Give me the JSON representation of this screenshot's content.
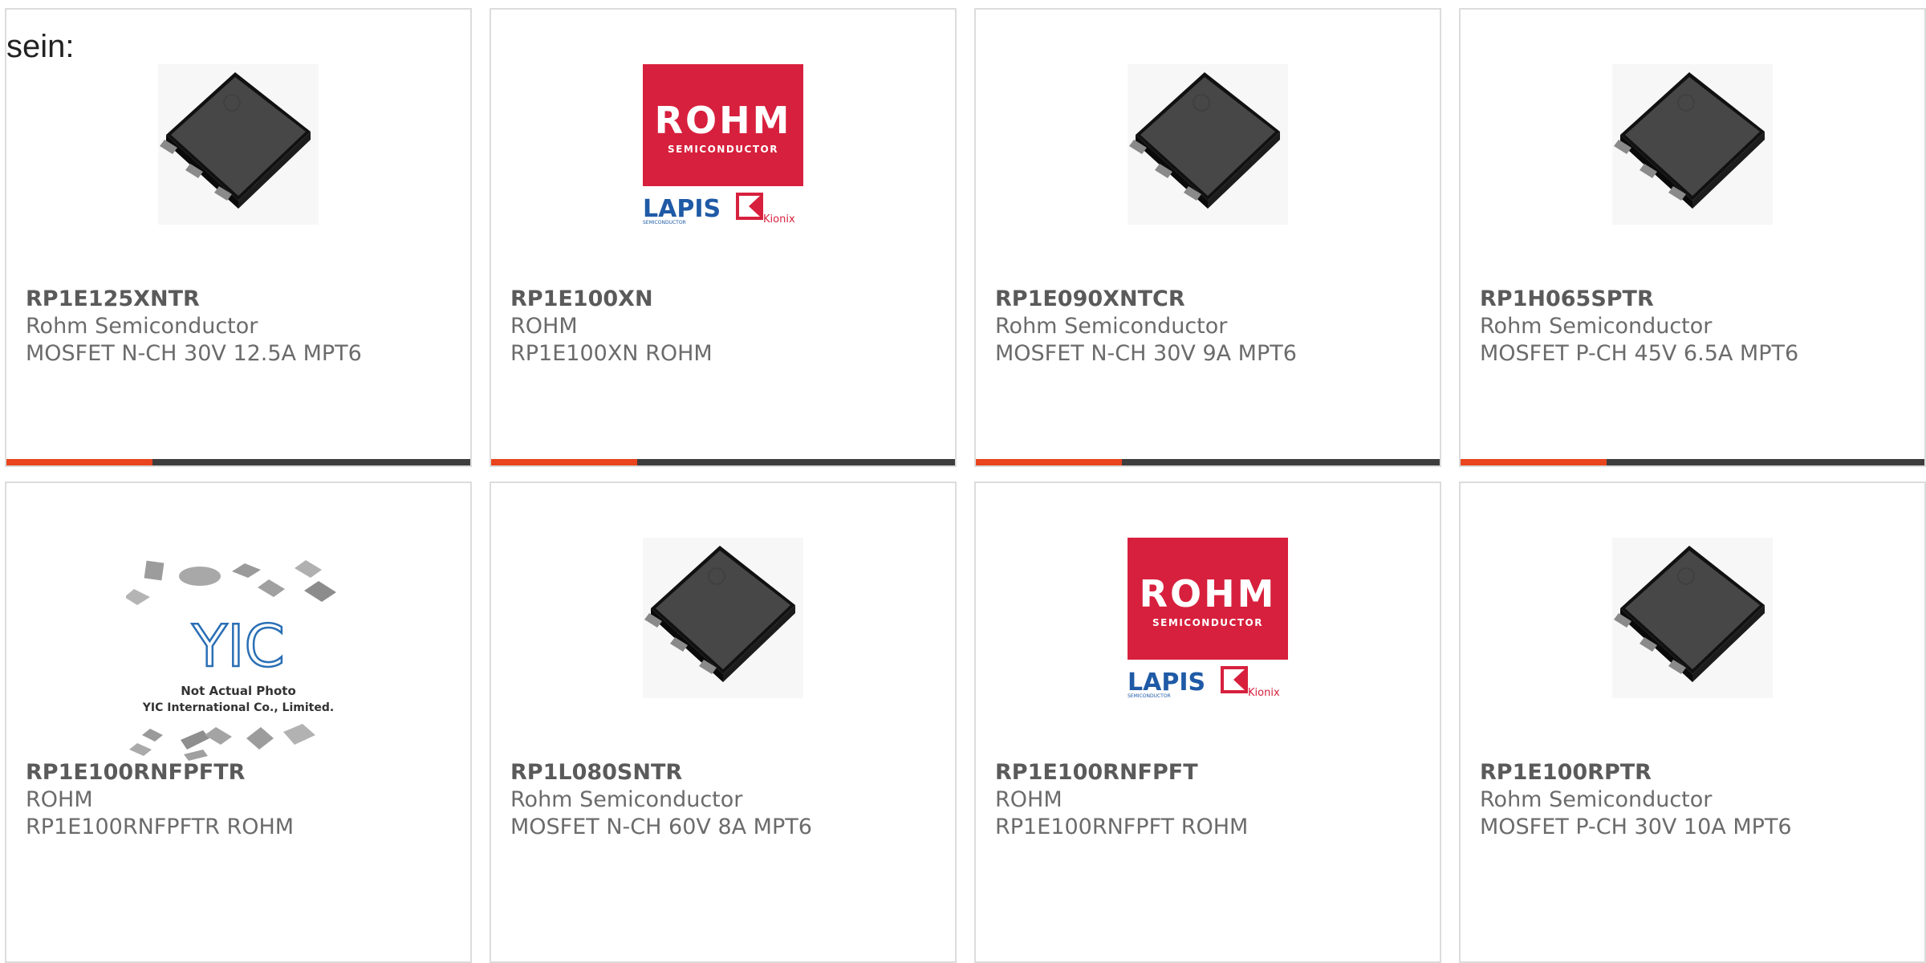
{
  "heading": "sein:",
  "products": [
    {
      "part": "RP1E125XNTR",
      "maker": "Rohm Semiconductor",
      "desc": "MOSFET N-CH 30V 12.5A MPT6",
      "image": "mosfet-package"
    },
    {
      "part": "RP1E100XN",
      "maker": "ROHM",
      "desc": "RP1E100XN ROHM",
      "image": "rohm-logo"
    },
    {
      "part": "RP1E090XNTCR",
      "maker": "Rohm Semiconductor",
      "desc": "MOSFET N-CH 30V 9A MPT6",
      "image": "mosfet-package"
    },
    {
      "part": "RP1H065SPTR",
      "maker": "Rohm Semiconductor",
      "desc": "MOSFET P-CH 45V 6.5A MPT6",
      "image": "mosfet-package"
    },
    {
      "part": "RP1E100RNFPFTR",
      "maker": "ROHM",
      "desc": "RP1E100RNFPFTR ROHM",
      "image": "yic-placeholder"
    },
    {
      "part": "RP1L080SNTR",
      "maker": "Rohm Semiconductor",
      "desc": "MOSFET N-CH 60V 8A MPT6",
      "image": "mosfet-package"
    },
    {
      "part": "RP1E100RNFPFT",
      "maker": "ROHM",
      "desc": "RP1E100RNFPFT ROHM",
      "image": "rohm-logo"
    },
    {
      "part": "RP1E100RPTR",
      "maker": "Rohm Semiconductor",
      "desc": "MOSFET P-CH 30V 10A MPT6",
      "image": "mosfet-package"
    }
  ],
  "logo_text": {
    "rohm": "ROHM",
    "semiconductor": "SEMICONDUCTOR",
    "lapis": "LAPIS",
    "lapis_sub": "SEMICONDUCTOR",
    "kionix": "Kionix",
    "yic": "YIC",
    "yic_caption_1": "Not Actual Photo",
    "yic_caption_2": "YIC International Co., Limited."
  },
  "colors": {
    "accent": "#e8441d",
    "bar": "#3d3d3d",
    "rohm_red": "#d7203d",
    "lapis_blue": "#1f5aa6"
  }
}
